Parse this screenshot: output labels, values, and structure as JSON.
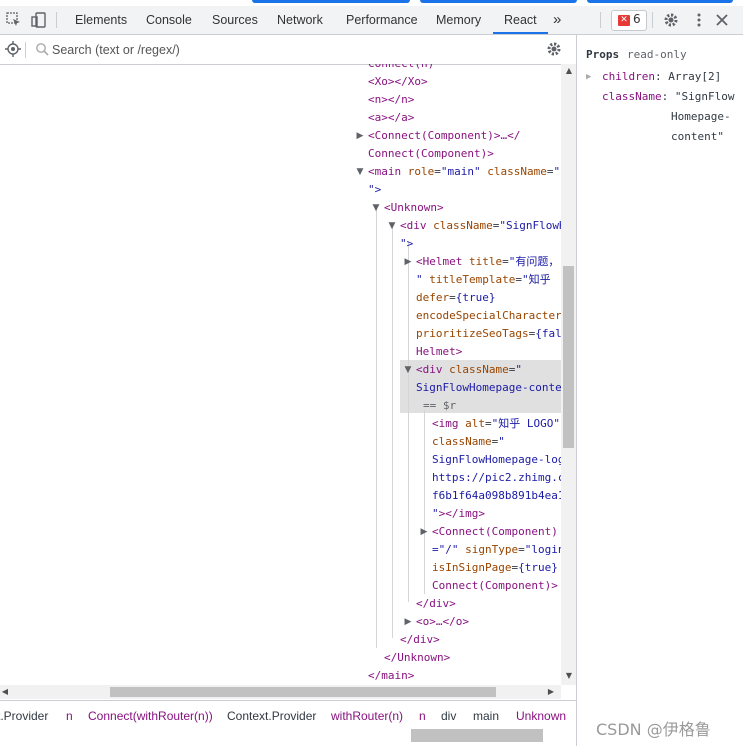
{
  "toolbar": {
    "tabs": [
      "Elements",
      "Console",
      "Sources",
      "Network",
      "Performance",
      "Memory",
      "React"
    ],
    "active_tab": "React",
    "more": "»",
    "error_count": "6"
  },
  "search": {
    "placeholder": "Search (text or /regex/)"
  },
  "tree": {
    "l0": "Connect(n)",
    "l1_open": "<Xo>",
    "l1_close": "</Xo>",
    "l2_open": "<n>",
    "l2_close": "</n>",
    "l3_open": "<a>",
    "l3_close": "</a>",
    "l4": "<Connect(Component)>…</",
    "l5": "Connect(Component)>",
    "l6_tag": "<main",
    "l6_a1": "role",
    "l6_v1": "\"main\"",
    "l6_a2": "className",
    "l6_v2": "\"",
    "l7": "\">",
    "l8": "<Unknown>",
    "l9_tag": "<div",
    "l9_a": "className",
    "l9_v": "\"SignFlowH",
    "l10": "\">",
    "l11_tag": "<Helmet",
    "l11_a": "title",
    "l11_v": "\"有问题，",
    "l12_v": "\"",
    "l12_a": "titleTemplate",
    "l12_v2": "\"知乎",
    "l13_a": "defer",
    "l13_v": "{true}",
    "l14_a": "encodeSpecialCharacter",
    "l15_a": "prioritizeSeoTags",
    "l15_v": "{fal",
    "l16": "Helmet>",
    "l17_tag": "<div",
    "l17_a": "className",
    "l17_v": "\"",
    "l18_v": "SignFlowHomepage-conte",
    "l19": "== $r",
    "l20_tag": "<img",
    "l20_a": "alt",
    "l20_v": "\"知乎 LOGO\"",
    "l21_a": "className",
    "l21_v": "\"",
    "l22_v": "SignFlowHomepage-log",
    "l23_v": "https://pic2.zhimg.c",
    "l24_v": "f6b1f64a098b891b4ea1",
    "l25_v": "\"",
    "l25_t": "></img>",
    "l26": "<Connect(Component)",
    "l27_v": "=\"/\"",
    "l27_a": "signType",
    "l27_v2": "\"login",
    "l28_a": "isInSignPage",
    "l28_v": "{true}",
    "l29": "Connect(Component)>",
    "l30": "</div>",
    "l31": "<o>…</o>",
    "l32": "</div>",
    "l33": "</Unknown>",
    "l34": "</main>"
  },
  "breadcrumbs": [
    "t.Provider",
    "n",
    "Connect(withRouter(n))",
    "Context.Provider",
    "withRouter(n)",
    "n",
    "div",
    "main",
    "Unknown"
  ],
  "props": {
    "header": "Props",
    "readonly": "read-only",
    "children_key": "children",
    "children_val": "Array[2]",
    "classname_key": "className",
    "classname_val_1": "\"SignFlow",
    "classname_val_2": "Homepage-",
    "classname_val_3": "content\""
  },
  "watermark": "CSDN @伊格鲁"
}
